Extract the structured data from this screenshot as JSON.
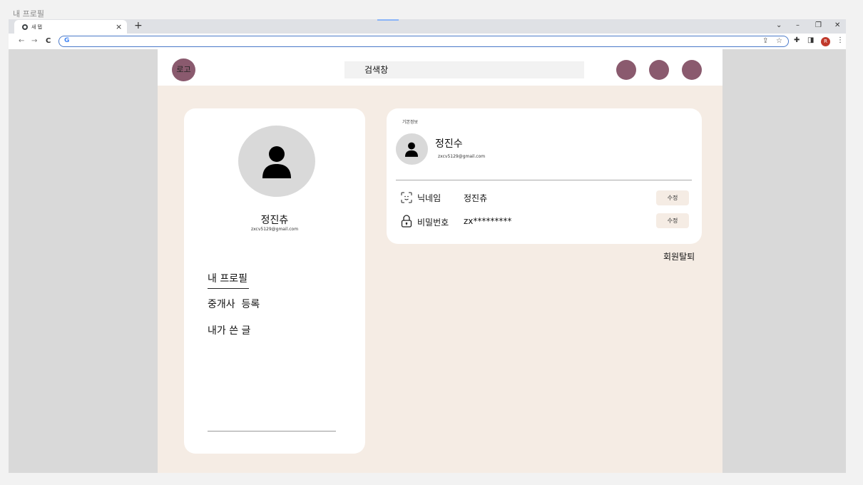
{
  "page_caption": "내 프로필",
  "browser": {
    "tab_title": "새 탭",
    "close_glyph": "×",
    "newtab_glyph": "+",
    "window_controls": [
      "⌄",
      "–",
      "❐",
      "✕"
    ],
    "nav": {
      "back": "←",
      "forward": "→",
      "reload": "C"
    },
    "omnibox_logo": "G",
    "omnibox_icons": [
      "share-icon",
      "star-icon"
    ],
    "toolbar_icons": [
      "extensions-icon",
      "sidepanel-icon"
    ],
    "profile_initial": "R",
    "menu_glyph": "⋮"
  },
  "header": {
    "logo_text": "로고",
    "search_text": "검색창",
    "accent_color": "#8a5a6e"
  },
  "profile_card": {
    "name": "정진츄",
    "email": "zxcv5129@gmail.com",
    "menu": [
      "내 프로필",
      "중개사  등록",
      "내가 쓴 글"
    ]
  },
  "info_card": {
    "section_label": "기본정보",
    "name": "정진수",
    "email": "zxcv5129@gmail.com",
    "rows": [
      {
        "icon": "face-scan-icon",
        "label": "닉네임",
        "value": "정진츄",
        "button": "수정"
      },
      {
        "icon": "lock-icon",
        "label": "비밀번호",
        "value": "zx*********",
        "button": "수정"
      }
    ]
  },
  "withdraw_label": "회원탈퇴",
  "colors": {
    "page_bg": "#f5ece4",
    "card_bg": "#ffffff",
    "side_bg": "#d9d9d9"
  }
}
